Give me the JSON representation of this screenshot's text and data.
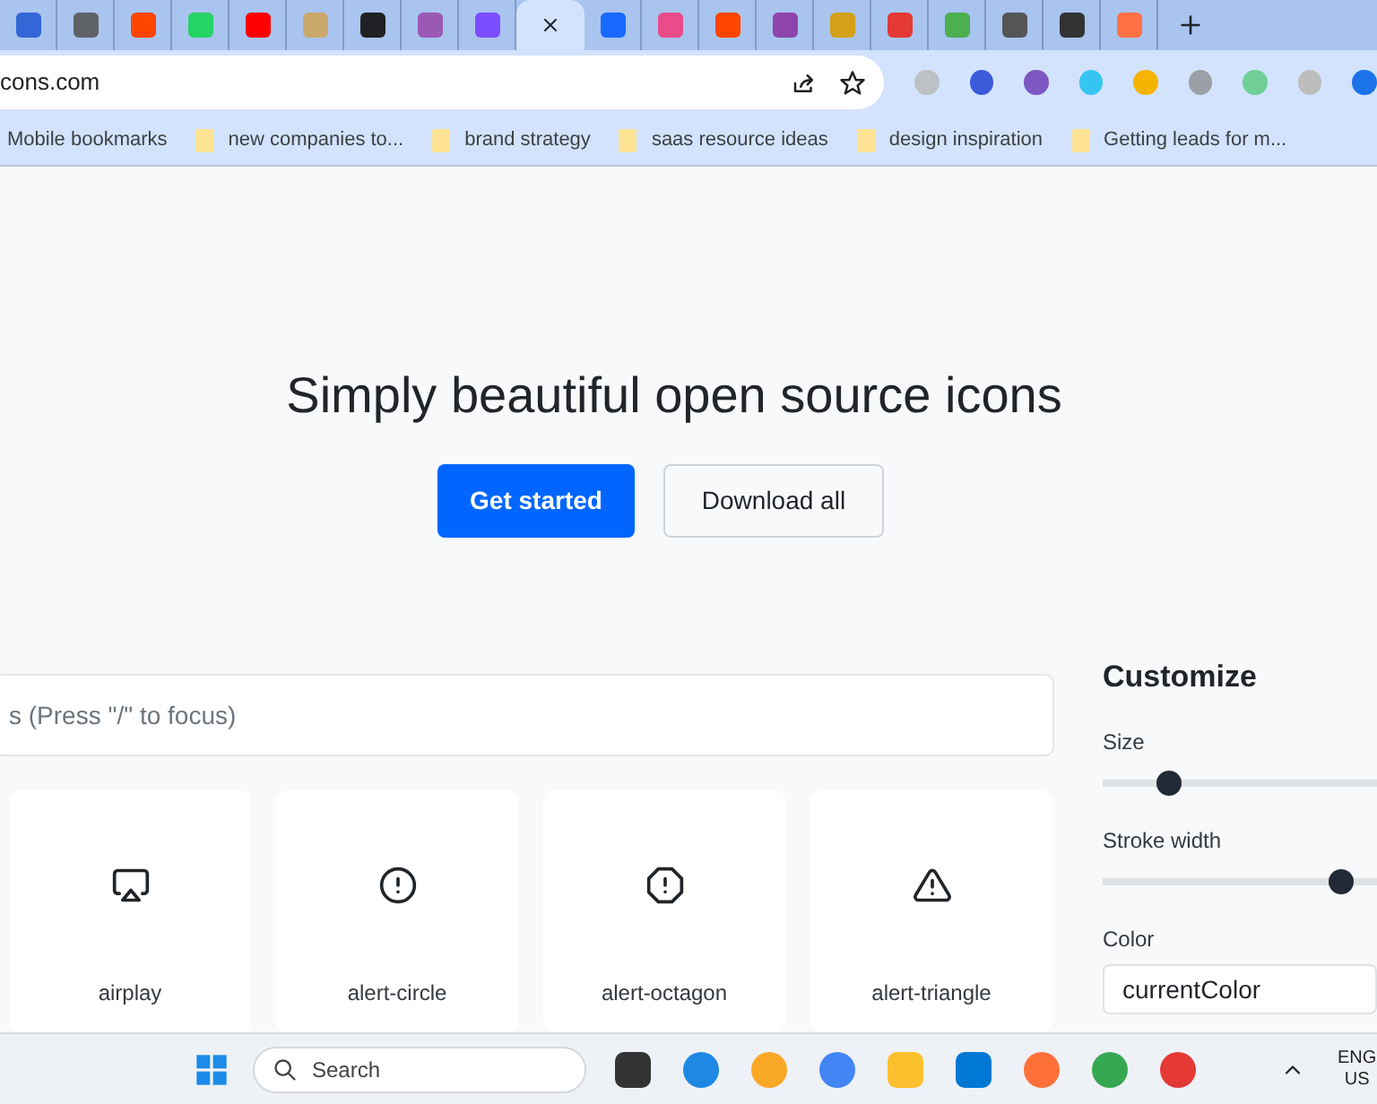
{
  "browser": {
    "tabs": [
      {
        "selected": false
      },
      {
        "selected": false
      },
      {
        "selected": false
      },
      {
        "selected": false
      },
      {
        "selected": false
      },
      {
        "selected": false
      },
      {
        "selected": false
      },
      {
        "selected": false
      },
      {
        "selected": false
      },
      {
        "selected": true
      },
      {
        "selected": false
      },
      {
        "selected": false
      },
      {
        "selected": false
      },
      {
        "selected": false
      },
      {
        "selected": false
      },
      {
        "selected": false
      },
      {
        "selected": false
      },
      {
        "selected": false
      },
      {
        "selected": false
      },
      {
        "selected": false
      }
    ],
    "address": "cons.com",
    "bookmarks": [
      "Mobile bookmarks",
      "new companies to...",
      "brand strategy",
      "saas resource ideas",
      "design inspiration",
      "Getting leads for m..."
    ]
  },
  "hero": {
    "title": "Simply beautiful open source icons",
    "primary_button": "Get started",
    "secondary_button": "Download all"
  },
  "search": {
    "placeholder": "s (Press \"/\" to focus)"
  },
  "icons": [
    {
      "kind": "airplay",
      "label": "airplay"
    },
    {
      "kind": "alert-circle",
      "label": "alert-circle"
    },
    {
      "kind": "alert-octagon",
      "label": "alert-octagon"
    },
    {
      "kind": "alert-triangle",
      "label": "alert-triangle"
    }
  ],
  "customize": {
    "title": "Customize",
    "sliders": [
      {
        "label": "Size",
        "level": 0.24
      },
      {
        "label": "Stroke width",
        "level": 0.87
      }
    ],
    "color_label": "Color",
    "color_value": "currentColor"
  },
  "taskbar": {
    "search_placeholder": "Search",
    "language": "ENG",
    "region": "US"
  }
}
